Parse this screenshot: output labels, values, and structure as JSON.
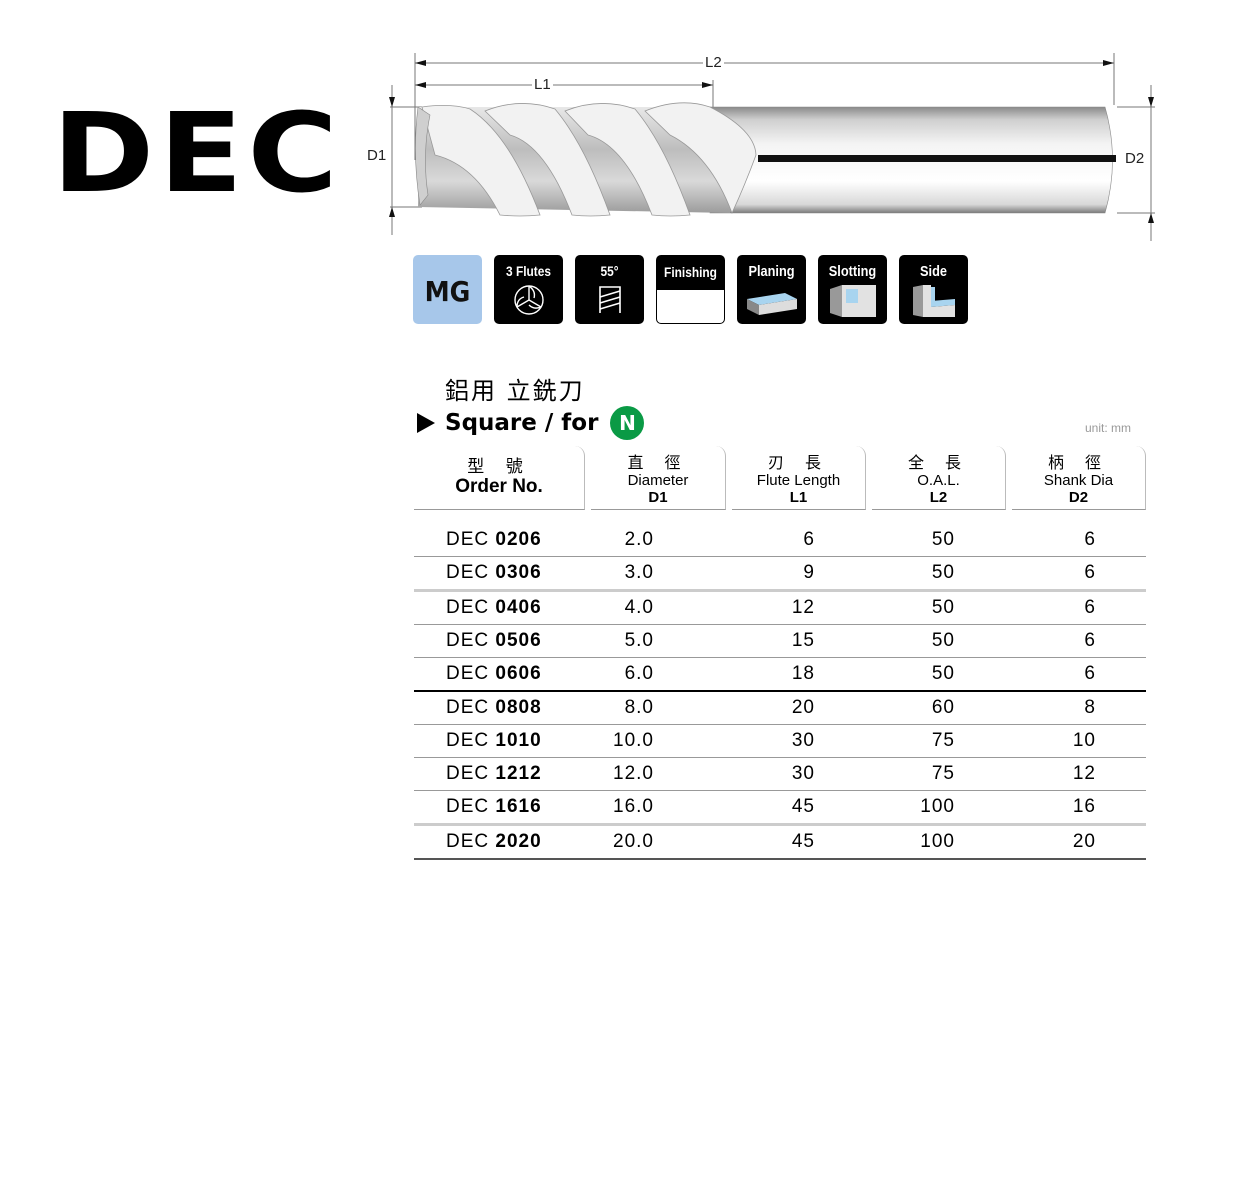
{
  "product": {
    "code": "DEC",
    "title_cn": "鋁用  立銑刀",
    "subtitle": "Square / for",
    "material_badge": "N",
    "material_color": "#0a9a45",
    "unit": "unit: mm"
  },
  "diagram": {
    "labels": {
      "L1": "L1",
      "L2": "L2",
      "D1": "D1",
      "D2": "D2"
    }
  },
  "badges": [
    {
      "label": "MG",
      "icon": "mg-grade-icon",
      "bg": "#a7c7ea"
    },
    {
      "label": "3 Flutes",
      "icon": "three-flutes-icon"
    },
    {
      "label": "55°",
      "icon": "helix-angle-icon"
    },
    {
      "label": "Finishing",
      "icon": "finishing-icon"
    },
    {
      "label": "Planing",
      "icon": "planing-icon"
    },
    {
      "label": "Slotting",
      "icon": "slotting-icon"
    },
    {
      "label": "Side",
      "icon": "side-milling-icon"
    }
  ],
  "table": {
    "headers": [
      {
        "cn": "型 號",
        "en": "Order No.",
        "code": ""
      },
      {
        "cn": "直 徑",
        "en": "Diameter",
        "code": "D1"
      },
      {
        "cn": "刃 長",
        "en": "Flute Length",
        "code": "L1"
      },
      {
        "cn": "全 長",
        "en": "O.A.L.",
        "code": "L2"
      },
      {
        "cn": "柄 徑",
        "en": "Shank Dia",
        "code": "D2"
      }
    ],
    "rows": [
      {
        "prefix": "DEC",
        "num": "0206",
        "d1": "2.0",
        "l1": "6",
        "l2": "50",
        "d2": "6"
      },
      {
        "prefix": "DEC",
        "num": "0306",
        "d1": "3.0",
        "l1": "9",
        "l2": "50",
        "d2": "6"
      },
      {
        "prefix": "DEC",
        "num": "0406",
        "d1": "4.0",
        "l1": "12",
        "l2": "50",
        "d2": "6"
      },
      {
        "prefix": "DEC",
        "num": "0506",
        "d1": "5.0",
        "l1": "15",
        "l2": "50",
        "d2": "6"
      },
      {
        "prefix": "DEC",
        "num": "0606",
        "d1": "6.0",
        "l1": "18",
        "l2": "50",
        "d2": "6"
      },
      {
        "prefix": "DEC",
        "num": "0808",
        "d1": "8.0",
        "l1": "20",
        "l2": "60",
        "d2": "8"
      },
      {
        "prefix": "DEC",
        "num": "1010",
        "d1": "10.0",
        "l1": "30",
        "l2": "75",
        "d2": "10"
      },
      {
        "prefix": "DEC",
        "num": "1212",
        "d1": "12.0",
        "l1": "30",
        "l2": "75",
        "d2": "12"
      },
      {
        "prefix": "DEC",
        "num": "1616",
        "d1": "16.0",
        "l1": "45",
        "l2": "100",
        "d2": "16"
      },
      {
        "prefix": "DEC",
        "num": "2020",
        "d1": "20.0",
        "l1": "45",
        "l2": "100",
        "d2": "20"
      }
    ]
  }
}
